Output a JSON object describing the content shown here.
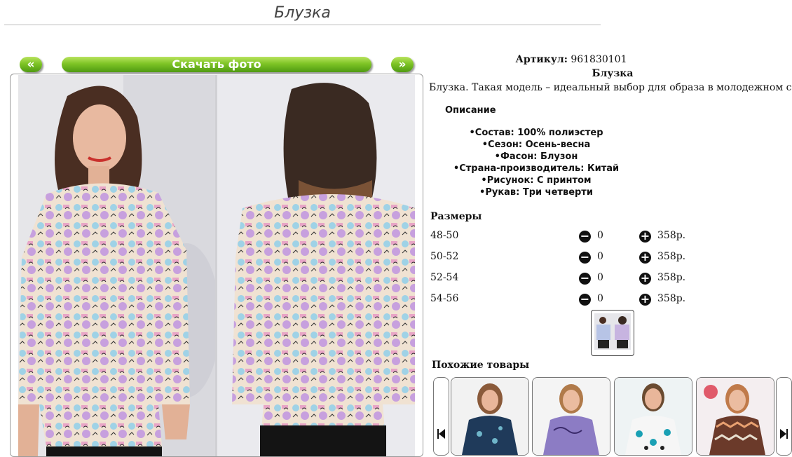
{
  "page": {
    "title": "Блузка"
  },
  "gallery": {
    "prev_label": "«",
    "next_label": "»",
    "download_label": "Скачать фото"
  },
  "product": {
    "sku_label": "Артикул:",
    "sku_value": "961830101",
    "name": "Блузка",
    "description": "Блузка. Такая модель – идеальный выбор для образа в молодежном стиле."
  },
  "description_section": {
    "heading": "Описание",
    "attributes": [
      "Состав: 100% полиэстер",
      "Сезон: Осень-весна",
      "Фасон: Блузон",
      "Страна-производитель: Китай",
      "Рисунок: С принтом",
      "Рукав: Три четверти"
    ]
  },
  "sizes": {
    "heading": "Размеры",
    "rows": [
      {
        "size": "48-50",
        "qty": "0",
        "price": "358р."
      },
      {
        "size": "50-52",
        "qty": "0",
        "price": "358р."
      },
      {
        "size": "52-54",
        "qty": "0",
        "price": "358р."
      },
      {
        "size": "54-56",
        "qty": "0",
        "price": "358р."
      }
    ],
    "minus_icon": "minus-circle-icon",
    "plus_icon": "plus-circle-icon"
  },
  "similar": {
    "heading": "Похожие товары",
    "prev_icon": "skip-previous-icon",
    "next_icon": "skip-next-icon"
  },
  "colors": {
    "button_green": "#7ec425",
    "title_gray": "#444444",
    "rule_gray": "#bdbdbd"
  }
}
